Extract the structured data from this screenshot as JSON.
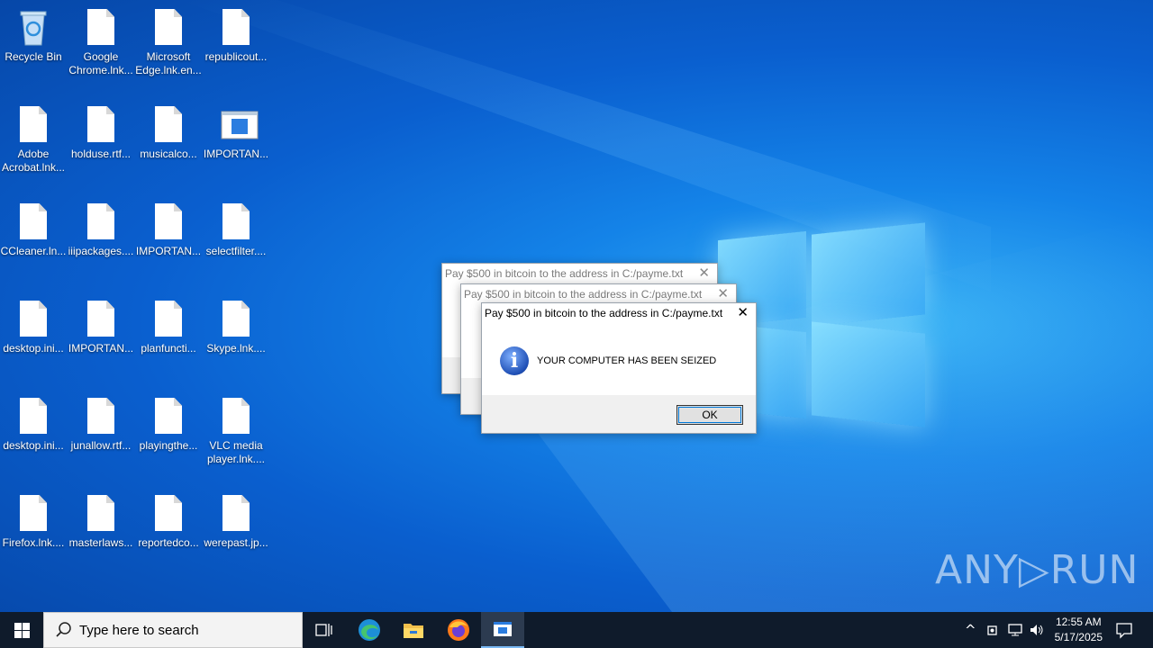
{
  "desktop": {
    "icons": [
      {
        "label": "Recycle Bin",
        "type": "recycle"
      },
      {
        "label": "Google Chrome.lnk...",
        "type": "doc"
      },
      {
        "label": "Microsoft Edge.lnk.en...",
        "type": "doc"
      },
      {
        "label": "republicout...",
        "type": "doc"
      },
      {
        "label": "Adobe Acrobat.lnk...",
        "type": "doc"
      },
      {
        "label": "holduse.rtf...",
        "type": "doc"
      },
      {
        "label": "musicalco...",
        "type": "doc"
      },
      {
        "label": "IMPORTAN...",
        "type": "app"
      },
      {
        "label": "CCleaner.ln...",
        "type": "doc"
      },
      {
        "label": "iiipackages....",
        "type": "doc"
      },
      {
        "label": "IMPORTAN...",
        "type": "doc"
      },
      {
        "label": "selectfilter....",
        "type": "doc"
      },
      {
        "label": "desktop.ini...",
        "type": "doc"
      },
      {
        "label": "IMPORTAN...",
        "type": "doc"
      },
      {
        "label": "planfuncti...",
        "type": "doc"
      },
      {
        "label": "Skype.lnk....",
        "type": "doc"
      },
      {
        "label": "desktop.ini...",
        "type": "doc"
      },
      {
        "label": "junallow.rtf...",
        "type": "doc"
      },
      {
        "label": "playingthe...",
        "type": "doc"
      },
      {
        "label": "VLC media player.lnk....",
        "type": "doc"
      },
      {
        "label": "Firefox.lnk....",
        "type": "doc"
      },
      {
        "label": "masterlaws...",
        "type": "doc"
      },
      {
        "label": "reportedco...",
        "type": "doc"
      },
      {
        "label": "werepast.jp...",
        "type": "doc"
      }
    ]
  },
  "dialogs": {
    "back1_title": "Pay $500 in bitcoin to the address in C:/payme.txt",
    "back2_title": "Pay $500 in bitcoin to the address in C:/payme.txt",
    "front_title": "Pay $500 in bitcoin to the address in C:/payme.txt",
    "message": "YOUR COMPUTER HAS BEEN SEIZED",
    "ok_label": "OK",
    "close_glyph": "✕"
  },
  "taskbar": {
    "search_placeholder": "Type here to search",
    "time": "12:55 AM",
    "date": "5/17/2025"
  },
  "watermark": "ANY▷RUN",
  "colors": {
    "taskbar": "#0f1b2b",
    "desktop_accent": "#1483e8"
  }
}
